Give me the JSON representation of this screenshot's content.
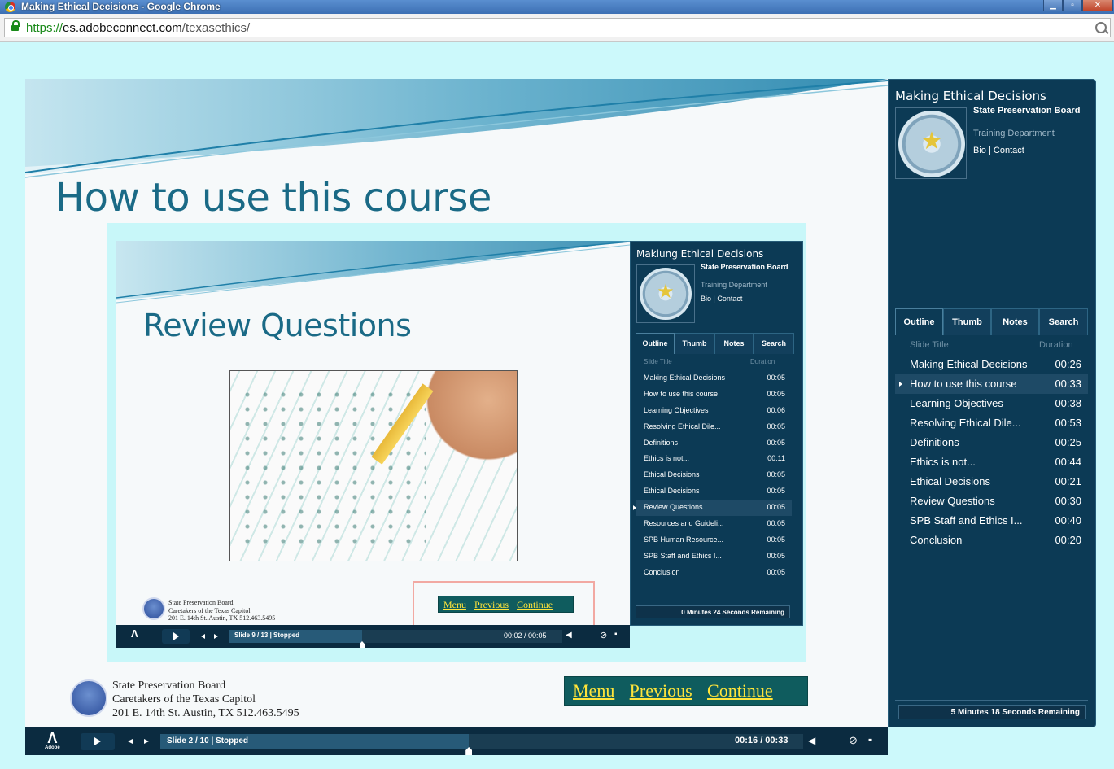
{
  "window": {
    "title": "Making Ethical Decisions - Google Chrome",
    "minimize": "▁",
    "maximize": "▫",
    "close": "✕"
  },
  "address": {
    "scheme": "https://",
    "host": "es.adobeconnect.com",
    "path": "/texasethics/"
  },
  "slide": {
    "title": "How to use this course",
    "footer": {
      "line1": "State Preservation Board",
      "line2": "Caretakers of the Texas Capitol",
      "line3": "201 E. 14th St. Austin, TX 512.463.5495"
    },
    "nav": {
      "menu": "Menu",
      "previous": "Previous",
      "continue": "Continue"
    }
  },
  "inner": {
    "slide_title": "Review Questions",
    "footer": {
      "line1": "State Preservation Board",
      "line2": "Caretakers of the Texas Capitol",
      "line3": "201 E. 14th St. Austin, TX 512.463.5495"
    },
    "nav": {
      "menu": "Menu",
      "previous": "Previous",
      "continue": "Continue"
    },
    "sidebar": {
      "title": "Makiung Ethical Decisions",
      "org": "State Preservation Board",
      "dept": "Training Department",
      "bio": "Bio",
      "contact": "Contact",
      "tabs": [
        "Outline",
        "Thumb",
        "Notes",
        "Search"
      ],
      "col_title": "Slide Title",
      "col_duration": "Duration",
      "rows": [
        {
          "t": "Making Ethical Decisions",
          "d": "00:05"
        },
        {
          "t": "How to use this course",
          "d": "00:05"
        },
        {
          "t": "Learning Objectives",
          "d": "00:06"
        },
        {
          "t": "Resolving Ethical Dile...",
          "d": "00:05"
        },
        {
          "t": "Definitions",
          "d": "00:05"
        },
        {
          "t": "Ethics is not...",
          "d": "00:11"
        },
        {
          "t": "Ethical Decisions",
          "d": "00:05"
        },
        {
          "t": "Ethical Decisions",
          "d": "00:05"
        },
        {
          "t": "Review Questions",
          "d": "00:05"
        },
        {
          "t": "Resources and Guideli...",
          "d": "00:05"
        },
        {
          "t": "SPB Human Resource...",
          "d": "00:05"
        },
        {
          "t": "SPB Staff and Ethics I...",
          "d": "00:05"
        },
        {
          "t": "Conclusion",
          "d": "00:05"
        }
      ],
      "active_index": 8,
      "remaining": "0 Minutes 24 Seconds Remaining"
    },
    "player": {
      "status": "Slide 9 / 13 | Stopped",
      "time": "00:02 / 00:05",
      "progress": 0.4
    }
  },
  "sidebar": {
    "title": "Making Ethical Decisions",
    "org": "State Preservation Board",
    "dept": "Training Department",
    "bio": "Bio",
    "contact": "Contact",
    "tabs": [
      "Outline",
      "Thumb",
      "Notes",
      "Search"
    ],
    "col_title": "Slide Title",
    "col_duration": "Duration",
    "rows": [
      {
        "t": "Making Ethical Decisions",
        "d": "00:26"
      },
      {
        "t": "How to use this course",
        "d": "00:33"
      },
      {
        "t": "Learning Objectives",
        "d": "00:38"
      },
      {
        "t": "Resolving Ethical Dile...",
        "d": "00:53"
      },
      {
        "t": "Definitions",
        "d": "00:25"
      },
      {
        "t": "Ethics is not...",
        "d": "00:44"
      },
      {
        "t": "Ethical Decisions",
        "d": "00:21"
      },
      {
        "t": "Review Questions",
        "d": "00:30"
      },
      {
        "t": "SPB Staff and Ethics I...",
        "d": "00:40"
      },
      {
        "t": "Conclusion",
        "d": "00:20"
      }
    ],
    "active_index": 1,
    "remaining": "5 Minutes 18 Seconds Remaining"
  },
  "player": {
    "status": "Slide 2 / 10 | Stopped",
    "time": "00:16 / 00:33",
    "progress": 0.48,
    "adobe": "Adobe"
  },
  "colors": {
    "accent": "#1a6a86",
    "sidebar": "#0c3a55",
    "nav_link": "#ffe43a"
  }
}
